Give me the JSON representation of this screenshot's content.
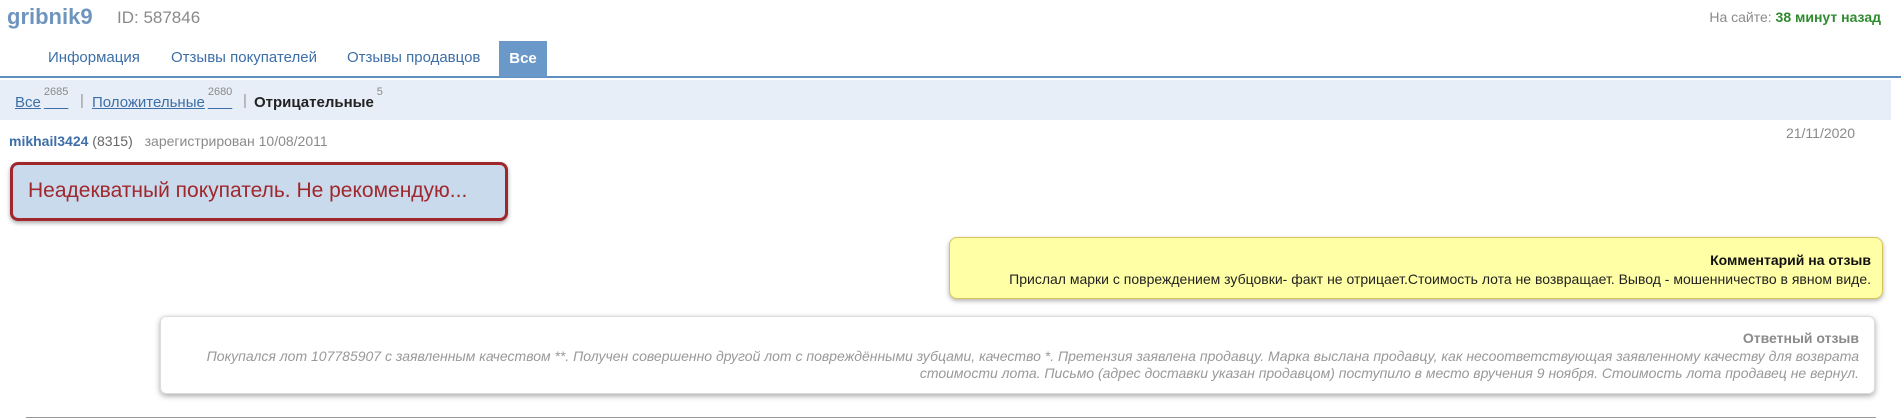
{
  "profile": {
    "username": "gribnik9",
    "id_label": "ID: 587846",
    "online_label": "На сайте:",
    "online_time": "38 минут назад"
  },
  "tabs": [
    {
      "label": "Информация"
    },
    {
      "label": "Отзывы покупателей"
    },
    {
      "label": "Отзывы продавцов"
    },
    {
      "label": "Все",
      "active": true
    }
  ],
  "filter": {
    "all_label": "Все",
    "all_count": "2685",
    "positive_label": "Положительные",
    "positive_count": "2680",
    "negative_label": "Отрицательные",
    "negative_count": "5",
    "separator": "|"
  },
  "review": {
    "author": "mikhail3424",
    "author_rating": "(8315)",
    "registered": "зарегистрирован 10/08/2011",
    "date": "21/11/2020",
    "text": "Неадекватный покупатель. Не рекомендую..."
  },
  "comment": {
    "title": "Комментарий на отзыв",
    "text": "Прислал марки с повреждением зубцовки- факт не отрицает.Стоимость лота не возвращает. Вывод - мошенничество в явном виде."
  },
  "response": {
    "title": "Ответный отзыв",
    "text": "Покупался лот 107785907 с заявленным качеством **. Получен совершенно другой лот с повреждёнными зубцами, качество *. Претензия заявлена продавцу. Марка выслана продавцу, как несоответствующая заявленному качеству для возврата стоимости лота. Письмо (адрес доставки указан продавцом) поступило в место вручения 9 ноября. Стоимость лота продавец не вернул."
  },
  "colors": {
    "accent": "#6a98c9",
    "link": "#3d6fa8",
    "negative": "#a0282d",
    "comment_bg": "#ffffa6",
    "online": "#2e8b2e"
  }
}
